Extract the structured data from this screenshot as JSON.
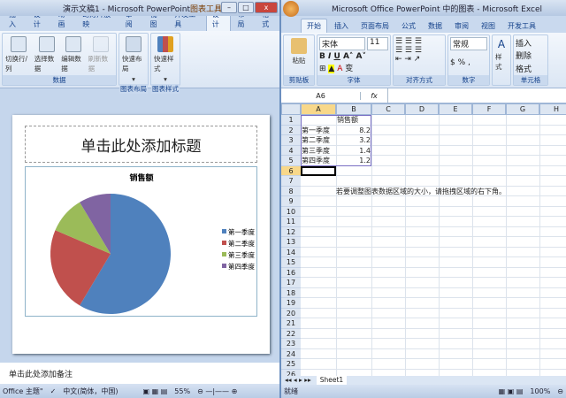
{
  "ppt": {
    "title": "演示文稿1 - Microsoft PowerPoint",
    "context_tab": "图表工具",
    "tabs": [
      "插入",
      "设计",
      "动画",
      "幻灯片放映",
      "审阅",
      "视图",
      "开发工具",
      "设计",
      "布局",
      "格式"
    ],
    "data_group": {
      "buttons": [
        "切换行/列",
        "选择数据",
        "编辑数据",
        "刷新数据"
      ],
      "label": "数据"
    },
    "layout_group": {
      "button": "快速布局",
      "label": "图表布局"
    },
    "style_group": {
      "button": "快速样式",
      "label": "图表样式"
    },
    "slide": {
      "title_placeholder": "单击此处添加标题"
    },
    "notes_placeholder": "单击此处添加备注",
    "status": {
      "theme": "Office 主题\"",
      "language": "中文(简体，中国)",
      "zoom": "55%"
    }
  },
  "chart_data": {
    "type": "pie",
    "title": "销售额",
    "categories": [
      "第一季度",
      "第二季度",
      "第三季度",
      "第四季度"
    ],
    "values": [
      8.2,
      3.2,
      1.4,
      1.2
    ],
    "colors": [
      "#4f81bd",
      "#c0504d",
      "#9bbb59",
      "#8064a2"
    ],
    "legend": "right"
  },
  "xl": {
    "title": "Microsoft Office PowerPoint 中的图表 - Microsoft Excel",
    "tabs": [
      "开始",
      "插入",
      "页面布局",
      "公式",
      "数据",
      "审阅",
      "视图",
      "开发工具"
    ],
    "clipboard": {
      "paste": "粘贴",
      "label": "剪贴板"
    },
    "font": {
      "name": "宋体",
      "size": "11",
      "label": "字体"
    },
    "align_label": "对齐方式",
    "number": {
      "format": "常规",
      "label": "数字"
    },
    "styles": "样式",
    "cells": {
      "insert": "插入",
      "delete": "删除",
      "format": "格式",
      "label": "单元格"
    },
    "name_box": "A6",
    "fx": "fx",
    "columns": [
      "A",
      "B",
      "C",
      "D",
      "E",
      "F",
      "G",
      "H"
    ],
    "grid": [
      [
        "",
        "销售额"
      ],
      [
        "第一季度",
        "8.2"
      ],
      [
        "第二季度",
        "3.2"
      ],
      [
        "第三季度",
        "1.4"
      ],
      [
        "第四季度",
        "1.2"
      ]
    ],
    "note": "若要调整图表数据区域的大小，请拖拽区域的右下角。",
    "sheet_tab": "Sheet1",
    "status": {
      "ready": "就绪",
      "zoom": "100%"
    }
  }
}
